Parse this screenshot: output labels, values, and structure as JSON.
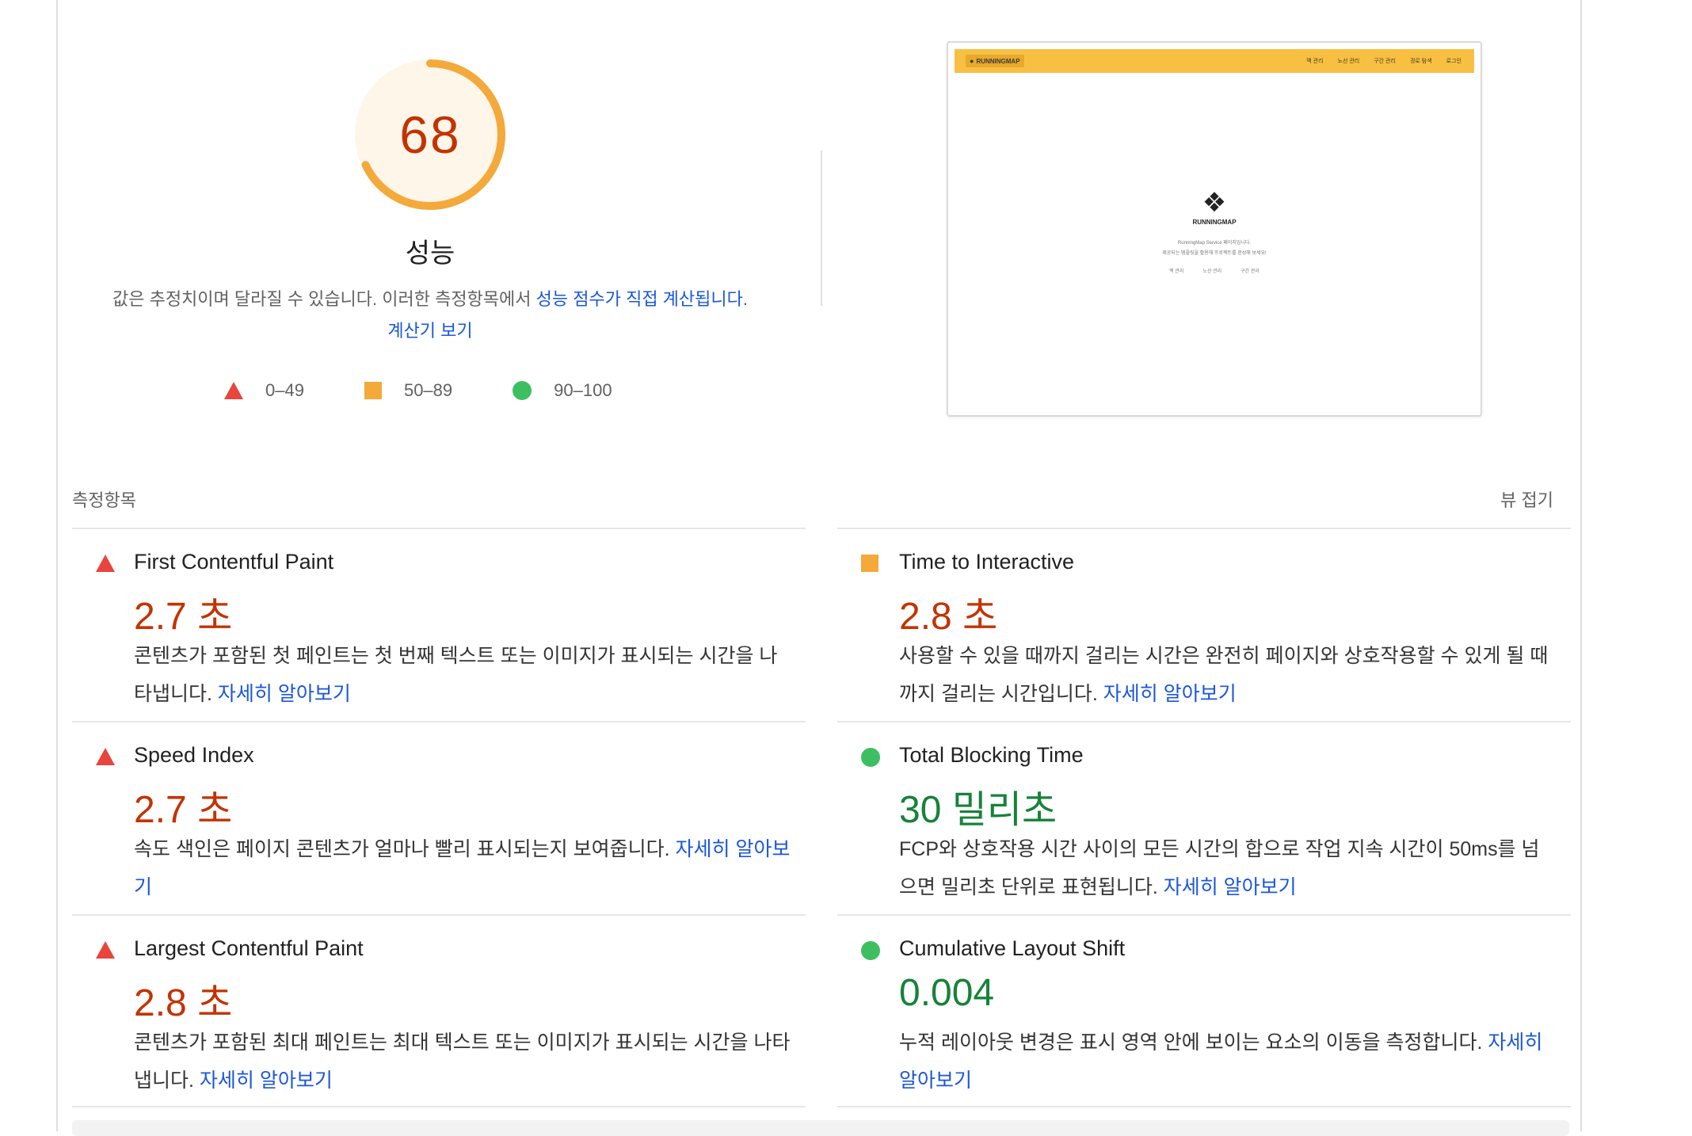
{
  "gauge": {
    "score": "68",
    "score_fraction": 0.68,
    "label": "성능",
    "desc_text": "값은 추정치이며 달라질 수 있습니다. 이러한 측정항목에서 ",
    "desc_link": "성능 점수가 직접 계산됩니다.",
    "calc_link": "계산기 보기",
    "color": "#f4a93b"
  },
  "legend": [
    {
      "range": "0–49",
      "shape": "triangle",
      "color": "#e8453c"
    },
    {
      "range": "50–89",
      "shape": "square",
      "color": "#f4a93b"
    },
    {
      "range": "90–100",
      "shape": "circle",
      "color": "#3dbf61"
    }
  ],
  "thumbnail": {
    "brand": "RUNNINGMAP",
    "menu": [
      "맥 관리",
      "노선 관리",
      "구간 관리",
      "경로 탐색",
      "로그인"
    ],
    "logo_text": "RUNNINGMAP",
    "line1": "RunningMap Service 페이지입니다.",
    "line2": "제공되는 템플릿을 활용해 프로젝트를 완성해 보세요!",
    "links": [
      "맥 관리",
      "노선 관리",
      "구간 관리"
    ]
  },
  "metrics_section": {
    "title": "측정항목",
    "collapse": "뷰 접기",
    "learn_more": "자세히 알아보기"
  },
  "metrics": [
    {
      "title": "First Contentful Paint",
      "value": "2.7 초",
      "status": "fail",
      "desc": "콘텐츠가 포함된 첫 페인트는 첫 번째 텍스트 또는 이미지가 표시되는 시간을 나타냅니다. "
    },
    {
      "title": "Time to Interactive",
      "value": "2.8 초",
      "status": "average",
      "desc": "사용할 수 있을 때까지 걸리는 시간은 완전히 페이지와 상호작용할 수 있게 될 때까지 걸리는 시간입니다. "
    },
    {
      "title": "Speed Index",
      "value": "2.7 초",
      "status": "fail",
      "desc": "속도 색인은 페이지 콘텐츠가 얼마나 빨리 표시되는지 보여줍니다. "
    },
    {
      "title": "Total Blocking Time",
      "value": "30 밀리초",
      "status": "pass",
      "desc": "FCP와 상호작용 시간 사이의 모든 시간의 합으로 작업 지속 시간이 50ms를 넘으면 밀리초 단위로 표현됩니다. "
    },
    {
      "title": "Largest Contentful Paint",
      "value": "2.8 초",
      "status": "fail",
      "desc": "콘텐츠가 포함된 최대 페인트는 최대 텍스트 또는 이미지가 표시되는 시간을 나타냅니다. "
    },
    {
      "title": "Cumulative Layout Shift",
      "value": "0.004",
      "status": "pass",
      "desc": "누적 레이아웃 변경은 표시 영역 안에 보이는 요소의 이동을 측정합니다. "
    }
  ]
}
